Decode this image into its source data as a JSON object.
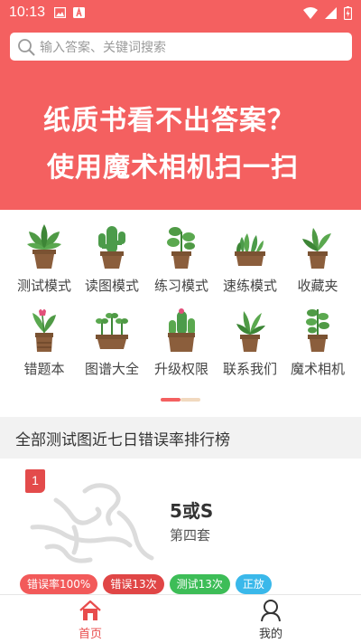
{
  "status_bar": {
    "time": "10:13"
  },
  "search": {
    "placeholder": "输入答案、关键词搜索"
  },
  "hero": {
    "line1": "纸质书看不出答案？",
    "line2": "使用魔术相机扫一扫"
  },
  "menu": {
    "row1": [
      {
        "label": "测试模式",
        "icon": "plant-icon"
      },
      {
        "label": "读图模式",
        "icon": "cactus-icon"
      },
      {
        "label": "练习模式",
        "icon": "plant-icon"
      },
      {
        "label": "速练模式",
        "icon": "succulent-icon"
      },
      {
        "label": "收藏夹",
        "icon": "plant-icon"
      }
    ],
    "row2": [
      {
        "label": "错题本",
        "icon": "tulip-icon"
      },
      {
        "label": "图谱大全",
        "icon": "seedling-icon"
      },
      {
        "label": "升级权限",
        "icon": "cactus-icon"
      },
      {
        "label": "联系我们",
        "icon": "plant-icon"
      },
      {
        "label": "魔术相机",
        "icon": "plant-icon"
      }
    ]
  },
  "section": {
    "title": "全部测试图近七日错误率排行榜"
  },
  "ranking": {
    "rank": "1",
    "title": "5或S",
    "subtitle": "第四套",
    "tags": [
      {
        "text": "错误率100%",
        "color": "#f25a5a"
      },
      {
        "text": "错误13次",
        "color": "#e04646"
      },
      {
        "text": "测试13次",
        "color": "#3dbd57"
      },
      {
        "text": "正放",
        "color": "#3ab8ea"
      }
    ]
  },
  "tabs": {
    "home": "首页",
    "mine": "我的"
  },
  "colors": {
    "brand": "#f46060",
    "tab_active": "#e84c4c",
    "tab_inactive": "#333333"
  }
}
